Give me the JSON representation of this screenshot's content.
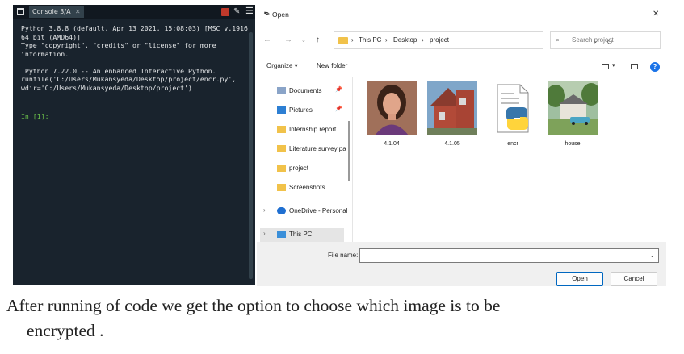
{
  "console": {
    "tab_label": "Console 3/A",
    "lines": [
      "Python 3.8.8 (default, Apr 13 2021, 15:08:03) [MSC v.1916",
      "64 bit (AMD64)]",
      "Type \"copyright\", \"credits\" or \"license\" for more",
      "information.",
      "",
      "IPython 7.22.0 -- An enhanced Interactive Python.",
      "runfile('C:/Users/Mukansyeda/Desktop/project/encr.py',",
      "wdir='C:/Users/Mukansyeda/Desktop/project')"
    ],
    "prompt": "In [1]:"
  },
  "dialog": {
    "title": "Open",
    "breadcrumb": [
      "This PC",
      "Desktop",
      "project"
    ],
    "search_placeholder": "Search project",
    "toolbar": {
      "organize": "Organize ▾",
      "new_folder": "New folder"
    },
    "nav_items": [
      {
        "label": "Documents",
        "pinned": true,
        "icon": "documents-icon"
      },
      {
        "label": "Pictures",
        "pinned": true,
        "icon": "pictures-icon"
      },
      {
        "label": "Internship report",
        "pinned": false,
        "icon": "folder-icon"
      },
      {
        "label": "Literature survey pa",
        "pinned": false,
        "icon": "folder-icon"
      },
      {
        "label": "project",
        "pinned": false,
        "icon": "folder-icon"
      },
      {
        "label": "Screenshots",
        "pinned": false,
        "icon": "folder-icon"
      },
      {
        "label": "OneDrive - Personal",
        "pinned": false,
        "icon": "onedrive-icon"
      },
      {
        "label": "This PC",
        "pinned": false,
        "icon": "this-pc-icon",
        "selected": true
      }
    ],
    "files": [
      {
        "name": "4.1.04",
        "icon": "portrait-photo-thumbnail"
      },
      {
        "name": "4.1.05",
        "icon": "house-photo-thumbnail"
      },
      {
        "name": "encr",
        "icon": "python-file-icon"
      },
      {
        "name": "house",
        "icon": "house-car-photo-thumbnail"
      }
    ],
    "file_name_label": "File name:",
    "file_name_value": "",
    "open_button": "Open",
    "cancel_button": "Cancel"
  },
  "caption": {
    "line1": "After running of code we get the option to choose which image is to be",
    "line2": "encrypted ."
  },
  "colors": {
    "console_bg": "#19232d",
    "prompt_green": "#6cc24a",
    "folder_yellow": "#f1c24a",
    "accent_blue": "#0067c0"
  }
}
